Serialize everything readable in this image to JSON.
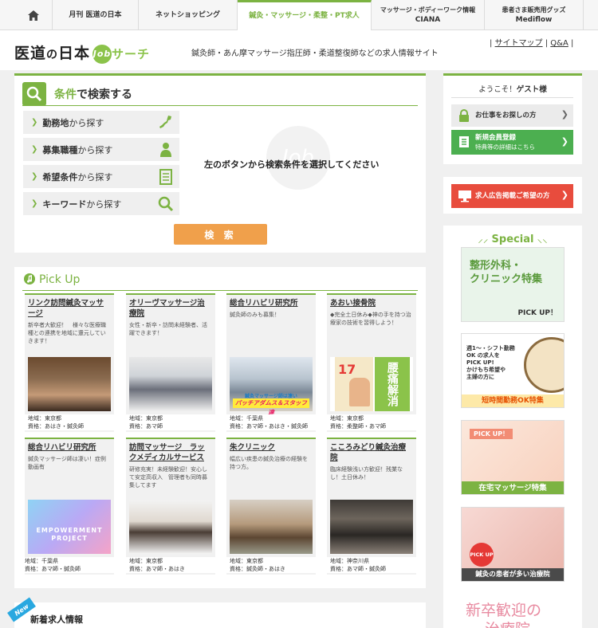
{
  "topnav": {
    "home_icon": "home-icon",
    "items": [
      {
        "label": "月刊 医道の日本",
        "sub": ""
      },
      {
        "label": "ネットショッピング",
        "sub": ""
      },
      {
        "label": "鍼灸・マッサージ・柔整・PT求人",
        "sub": ""
      },
      {
        "label": "マッサージ・ボディーワーク情報",
        "sub": "CIANA"
      },
      {
        "label": "患者さま販売用グッズ",
        "sub": "Mediflow"
      }
    ]
  },
  "header": {
    "logo_main": "医道",
    "logo_no": "の",
    "logo_main2": "日本",
    "logo_job": "Job",
    "logo_search": "サーチ",
    "tagline": "鍼灸師・あん摩マッサージ指圧師・柔道整復師などの求人情報サイト",
    "links": [
      "サイトマップ",
      "Q&A"
    ]
  },
  "search": {
    "title_accent": "条件",
    "title_rest": "で検索する",
    "buttons": [
      {
        "bold": "勤務地",
        "rest": "から探す",
        "icon": "japan-map-icon"
      },
      {
        "bold": "募集職種",
        "rest": "から探す",
        "icon": "person-icon"
      },
      {
        "bold": "希望条件",
        "rest": "から探す",
        "icon": "document-icon"
      },
      {
        "bold": "キーワード",
        "rest": "から探す",
        "icon": "search-icon"
      }
    ],
    "message": "左のボタンから検索条件を選択してください",
    "watermark": "Job",
    "submit": "検 索"
  },
  "pickup": {
    "title": "Pick Up",
    "cards": [
      {
        "title": "リンク訪問鍼灸マッサージ",
        "desc": "新卒者大歓迎！　様々な医療職種との連携を地域に還元していきます！",
        "area": "地域：東京都",
        "qual": "資格：あはき・鍼灸師"
      },
      {
        "title": "オリーヴマッサージ治療院",
        "desc": "女性・新卒・訪問未経験者、活躍できます！",
        "area": "地域：東京都",
        "qual": "資格：あマ師"
      },
      {
        "title": "総合リハビリ研究所",
        "desc": "鍼灸師のみも募集！",
        "area": "地域：千葉県",
        "qual": "資格：あマ師・あはき・鍼灸師"
      },
      {
        "title": "あおい接骨院",
        "desc": "◆完全土日休み◆神の手を持つ治療家の技術を習得しよう！",
        "area": "地域：東京都",
        "qual": "資格：柔整師・あマ師"
      },
      {
        "title": "総合リハビリ研究所",
        "desc": "鍼灸マッサージ師は凄い！症例動画有",
        "area": "地域：千葉県",
        "qual": "資格：あマ師・鍼灸師"
      },
      {
        "title": "訪問マッサージ　ラックメディカルサービス",
        "desc": "研修充実！未経験歓迎！安心して安定高収入　管理者も同時募集してます",
        "area": "地域：東京都",
        "qual": "資格：あマ師・あはき"
      },
      {
        "title": "朱クリニック",
        "desc": "幅広い疾患の鍼灸治療の経験を持つ方。",
        "area": "地域：東京都",
        "qual": "資格：鍼灸師・あはき"
      },
      {
        "title": "こころみどり鍼灸治療院",
        "desc": "臨床経験浅い方歓迎！残業なし！土日休み！",
        "area": "地域：神奈川県",
        "qual": "資格：あマ師・鍼灸師"
      }
    ],
    "img_text_3": "パッチアダムス＆スタッフ達",
    "img_text_3b": "鍼灸マッサージ師は凄い",
    "img_text_4a": "腰痛",
    "img_text_4b": "解消",
    "img_text_4c": "17",
    "img_text_5a": "EMPOWERMENT",
    "img_text_5b": "PROJECT"
  },
  "newjobs": {
    "badge": "New",
    "title": "新着求人情報"
  },
  "sidebar": {
    "welcome": "ようこそ！",
    "welcome_guest": "ゲスト様",
    "btn_search": "お仕事をお探しの方",
    "btn_register": "新規会員登録",
    "btn_register_sub": "特典等の詳細はこちら",
    "btn_ad": "求人広告掲載ご希望の方",
    "special": "Special",
    "banners": [
      {
        "title": "整形外科・\nクリニック特集",
        "tag": "PICK UP！"
      },
      {
        "title": "週1〜・シフト勤務\nOK の求人を\nPICK UP!\nかけもち希望や\n主婦の方に",
        "tag": "短時間勤務OK特集"
      },
      {
        "title": "PICK UP！",
        "tag": "在宅マッサージ特集"
      },
      {
        "title": "PICK UP",
        "tag": "鍼灸の患者が多い治療院"
      },
      {
        "title": "新卒歓迎の",
        "tag": "治療院"
      }
    ]
  },
  "colors": {
    "accent": "#7cb342",
    "orange": "#f0a04b",
    "red": "#e74c3c",
    "green_btn": "#4caf50"
  }
}
